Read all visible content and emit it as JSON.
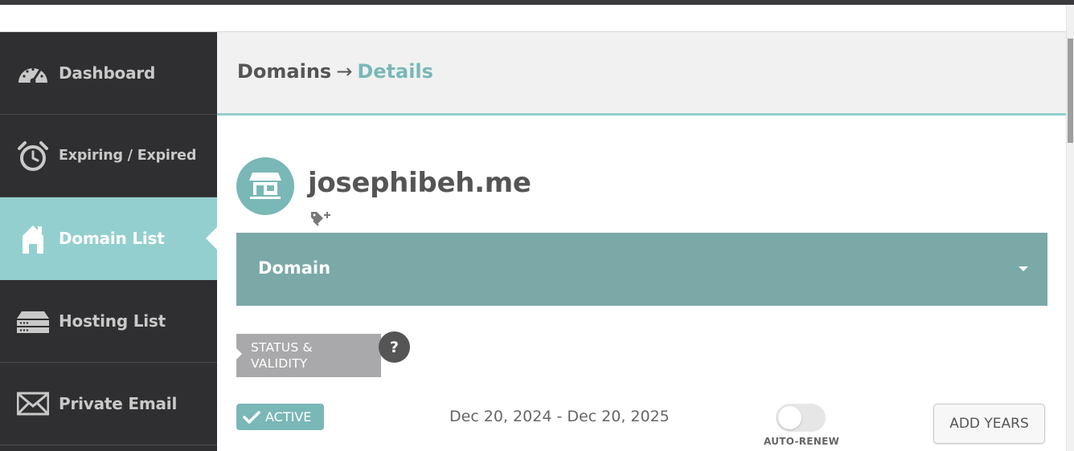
{
  "sidebar": {
    "items": [
      {
        "label": "Dashboard",
        "icon": "speedometer-icon"
      },
      {
        "label": "Expiring / Expired",
        "icon": "timer-icon"
      },
      {
        "label": "Domain List",
        "icon": "house-icon",
        "active": true
      },
      {
        "label": "Hosting List",
        "icon": "server-icon"
      },
      {
        "label": "Private Email",
        "icon": "envelope-icon"
      }
    ]
  },
  "header": {
    "breadcrumb_parent": "Domains",
    "breadcrumb_separator": "→",
    "breadcrumb_current": "Details"
  },
  "domain": {
    "name": "josephibeh.me",
    "avatar_icon": "storefront-icon",
    "tag_icon": "add-tag-icon"
  },
  "panel": {
    "title": "Domain",
    "caret_icon": "caret-down-icon"
  },
  "status": {
    "section_label_line1": "STATUS &",
    "section_label_line2": "VALIDITY",
    "help_label": "?",
    "badge_label": "ACTIVE",
    "date_range": "Dec 20, 2024 - Dec 20, 2025",
    "auto_renew_label": "AUTO-RENEW",
    "auto_renew_on": false,
    "add_years_label": "ADD YEARS"
  },
  "colors": {
    "accent": "#94cfcf",
    "accent_dark": "#7ab7b7",
    "panel": "#7aa9a8",
    "sidebar": "#2f2f31"
  }
}
